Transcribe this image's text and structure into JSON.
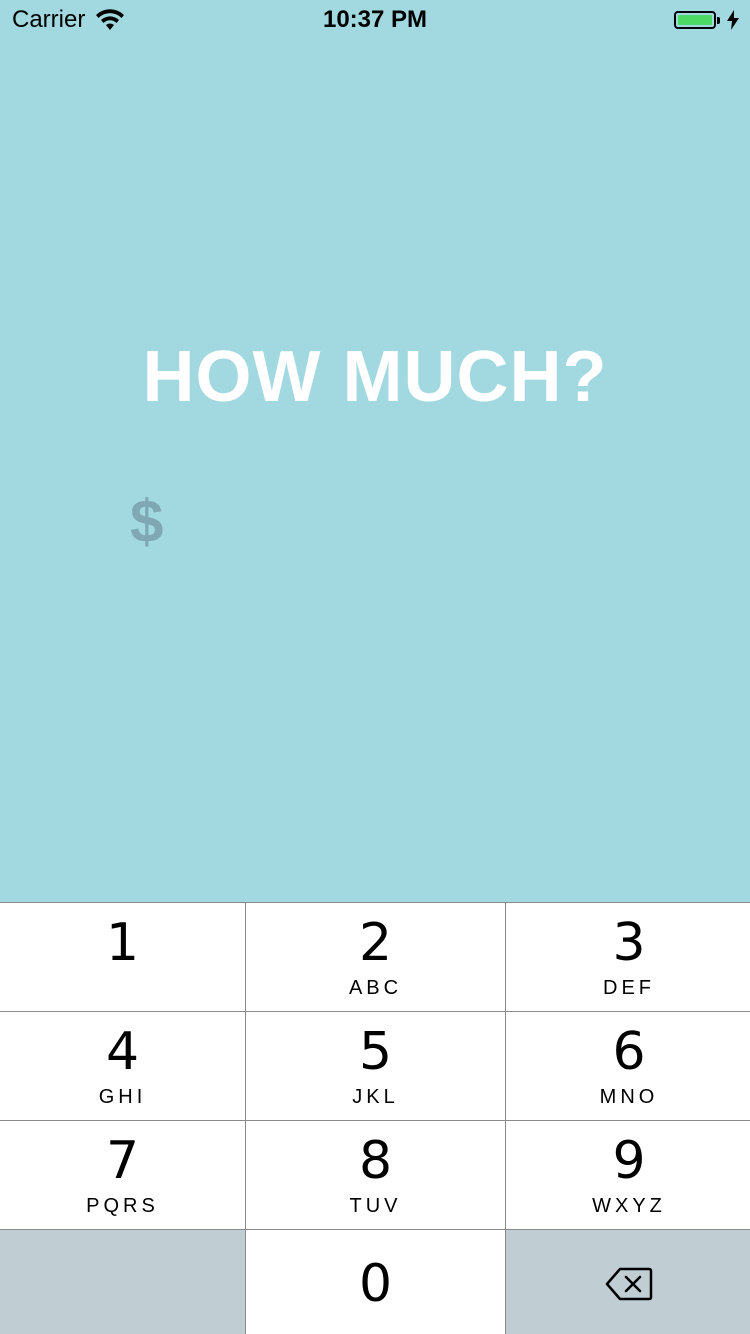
{
  "status_bar": {
    "carrier": "Carrier",
    "time": "10:37 PM",
    "battery_color": "#4cd964"
  },
  "main": {
    "prompt": "HOW MUCH?",
    "currency_symbol": "$",
    "amount_value": "",
    "background_color": "#a2d9e0"
  },
  "keypad": {
    "keys": [
      {
        "digit": "1",
        "letters": ""
      },
      {
        "digit": "2",
        "letters": "ABC"
      },
      {
        "digit": "3",
        "letters": "DEF"
      },
      {
        "digit": "4",
        "letters": "GHI"
      },
      {
        "digit": "5",
        "letters": "JKL"
      },
      {
        "digit": "6",
        "letters": "MNO"
      },
      {
        "digit": "7",
        "letters": "PQRS"
      },
      {
        "digit": "8",
        "letters": "TUV"
      },
      {
        "digit": "9",
        "letters": "WXYZ"
      },
      {
        "digit": "0",
        "letters": ""
      }
    ],
    "delete_icon": "delete-backspace-icon"
  }
}
